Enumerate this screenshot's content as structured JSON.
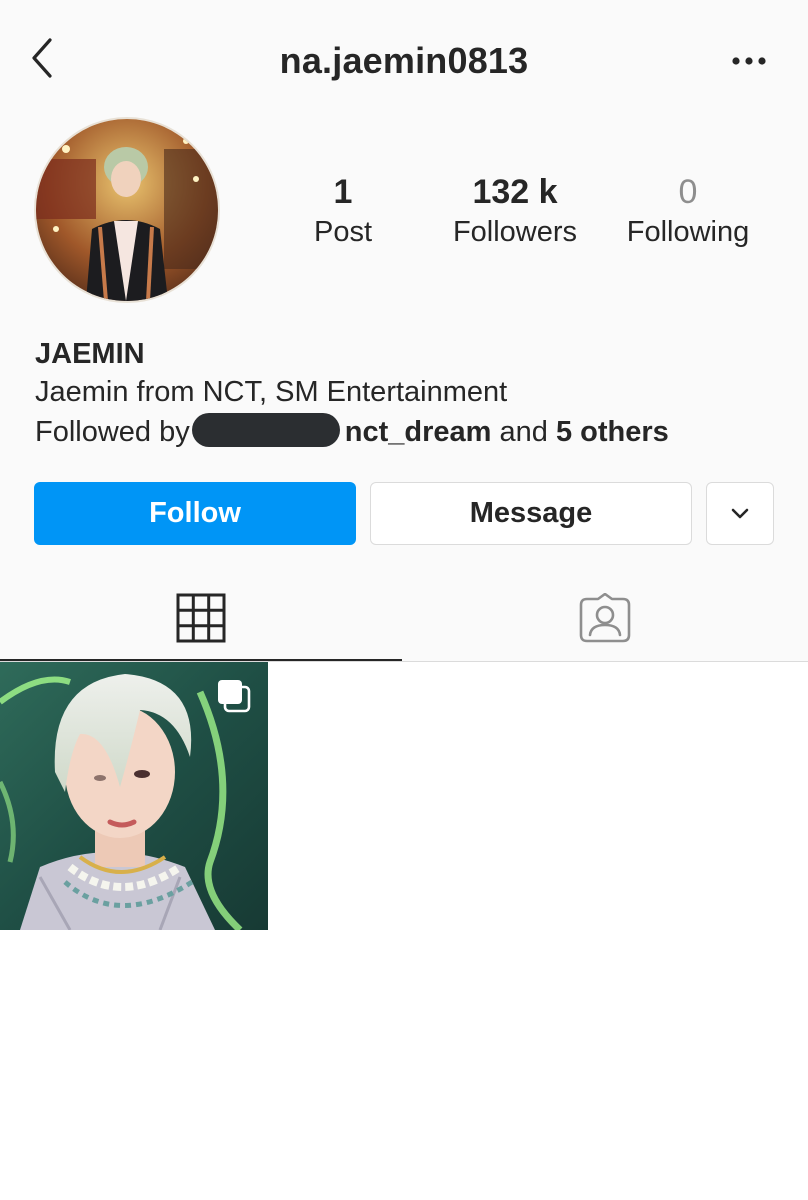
{
  "header": {
    "back_icon": "chevron-left-icon",
    "username": "na.jaemin0813",
    "more_icon": "more-horizontal-icon"
  },
  "profile": {
    "avatar_description": "profile-photo",
    "stats": {
      "posts": {
        "value": "1",
        "label": "Post"
      },
      "followers": {
        "value": "132 k",
        "label": "Followers"
      },
      "following": {
        "value": "0",
        "label": "Following"
      }
    },
    "display_name": "JAEMIN",
    "bio": "Jaemin from NCT, SM Entertainment",
    "followed_by": {
      "prefix": "Followed by",
      "account": "nct_dream",
      "conjunction": "and",
      "others": "5 others"
    }
  },
  "actions": {
    "follow_label": "Follow",
    "message_label": "Message",
    "dropdown_icon": "chevron-down-icon"
  },
  "tabs": [
    {
      "icon": "grid-icon",
      "active": true
    },
    {
      "icon": "tagged-person-icon",
      "active": false
    }
  ],
  "posts": [
    {
      "type": "multi-photo",
      "overlay_icon": "carousel-icon"
    }
  ],
  "colors": {
    "accent": "#0095f6",
    "background": "#fafafa",
    "text": "#262626",
    "muted": "#8e8e8e",
    "border": "#dbdbdb"
  }
}
